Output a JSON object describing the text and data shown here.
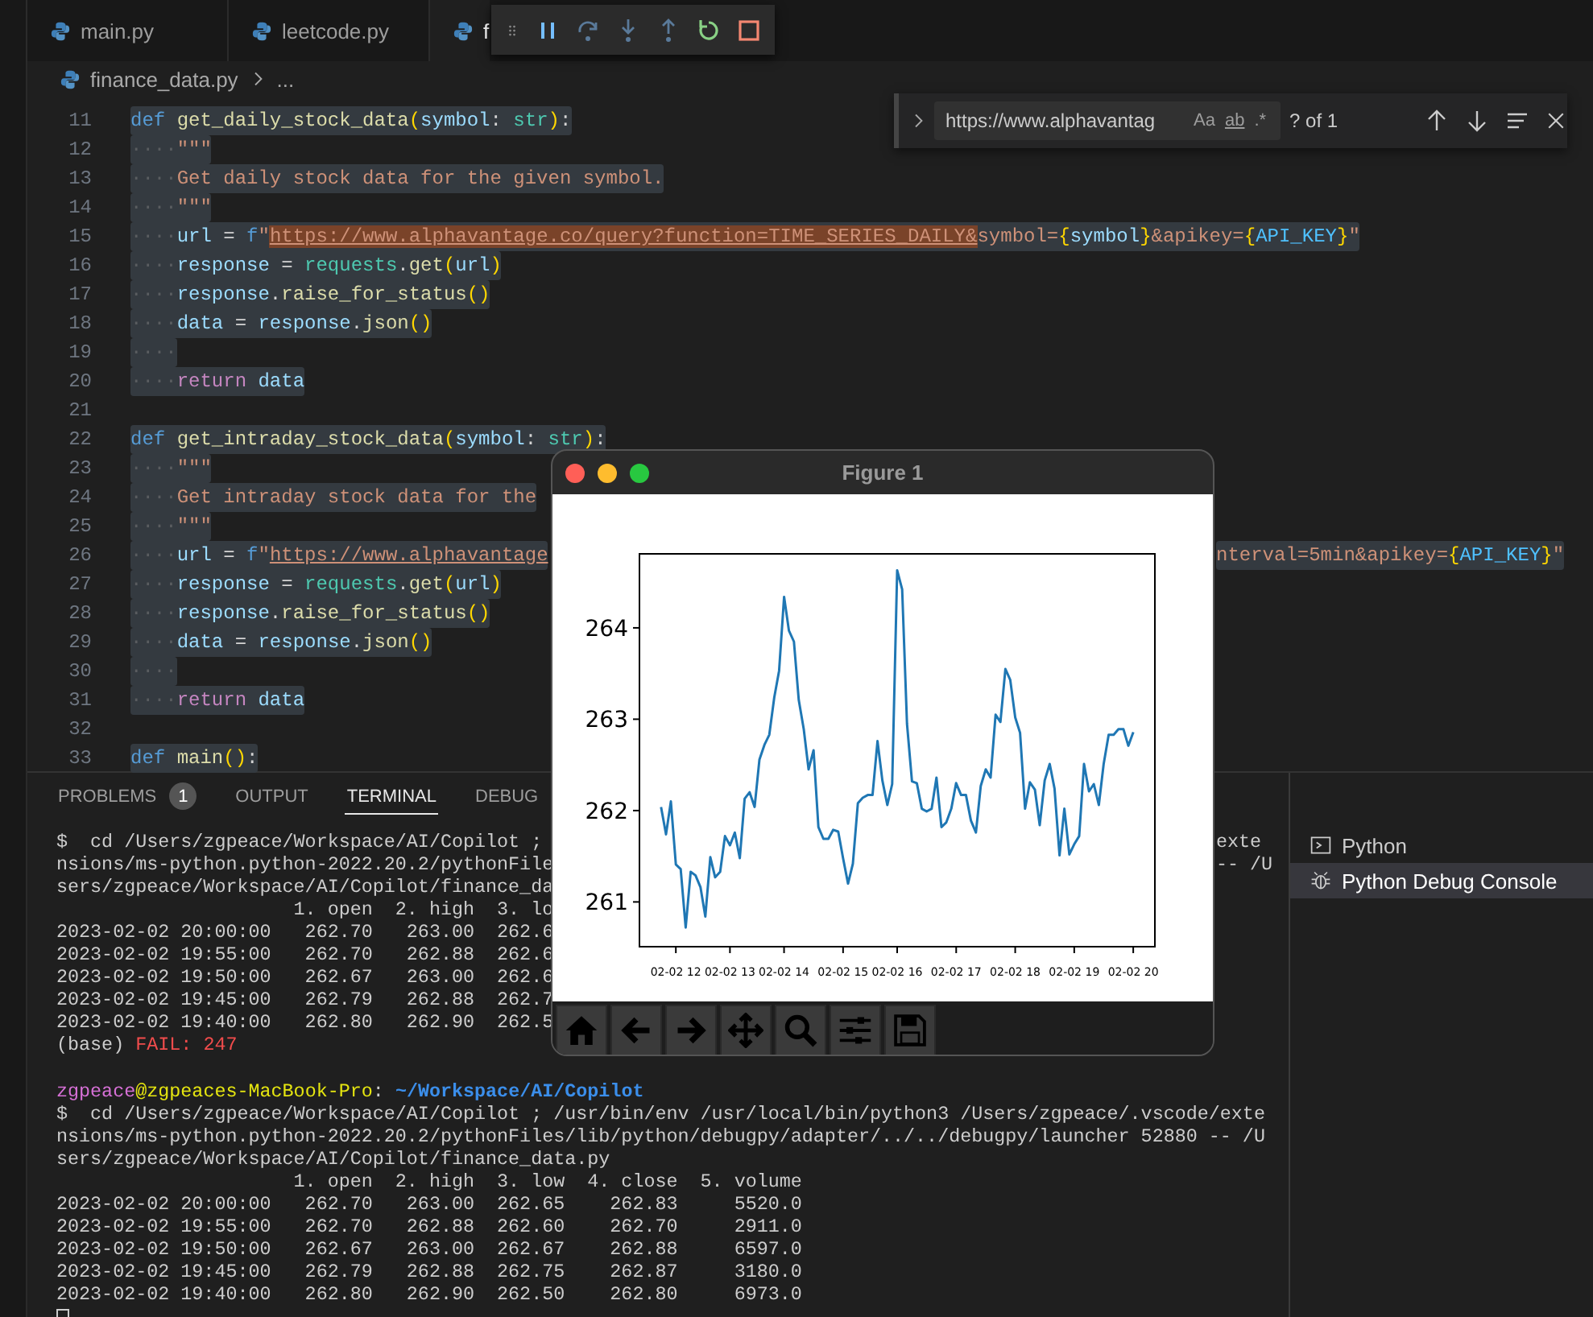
{
  "tabs": [
    {
      "label": "main.py",
      "selected": false
    },
    {
      "label": "leetcode.py",
      "selected": false
    },
    {
      "label": "f",
      "selected": true
    }
  ],
  "breadcrumb": {
    "file": "finance_data.py",
    "more": "..."
  },
  "find_widget": {
    "value": "https://www.alphavantag",
    "options": [
      "Aa",
      "ab",
      ".*"
    ],
    "result": "? of 1"
  },
  "editor": {
    "lines": [
      {
        "number": "11",
        "tokens": [
          {
            "text": "def ",
            "kind": "kw"
          },
          {
            "text": "get_daily_stock_data",
            "kind": "fn"
          },
          {
            "text": "(",
            "kind": "brace"
          },
          {
            "text": "symbol",
            "kind": "param"
          },
          {
            "text": ": ",
            "kind": "punc"
          },
          {
            "text": "str",
            "kind": "type"
          },
          {
            "text": ")",
            "kind": "brace"
          },
          {
            "text": ":",
            "kind": "punc"
          }
        ]
      },
      {
        "number": "12",
        "tokens": [
          {
            "text": "····",
            "kind": "ws"
          },
          {
            "text": "\"\"\"",
            "kind": "str"
          }
        ]
      },
      {
        "number": "13",
        "tokens": [
          {
            "text": "····",
            "kind": "ws"
          },
          {
            "text": "Get daily stock data for the given symbol.",
            "kind": "str"
          }
        ]
      },
      {
        "number": "14",
        "tokens": [
          {
            "text": "····",
            "kind": "ws"
          },
          {
            "text": "\"\"\"",
            "kind": "str"
          }
        ]
      },
      {
        "number": "15",
        "tokens": [
          {
            "text": "····",
            "kind": "ws"
          },
          {
            "text": "url",
            "kind": "var"
          },
          {
            "text": " = ",
            "kind": "punc"
          },
          {
            "text": "f",
            "kind": "kw"
          },
          {
            "text": "\"",
            "kind": "str"
          },
          {
            "text": "https://www.alphavantage.co/query?function=TIME_SERIES_DAILY&",
            "kind": "match"
          },
          {
            "text": "symbol=",
            "kind": "str"
          },
          {
            "text": "{",
            "kind": "brace"
          },
          {
            "text": "symbol",
            "kind": "var"
          },
          {
            "text": "}",
            "kind": "brace"
          },
          {
            "text": "&apikey=",
            "kind": "str"
          },
          {
            "text": "{",
            "kind": "brace"
          },
          {
            "text": "API_KEY",
            "kind": "const"
          },
          {
            "text": "}",
            "kind": "brace"
          },
          {
            "text": "\"",
            "kind": "str"
          }
        ]
      },
      {
        "number": "16",
        "tokens": [
          {
            "text": "····",
            "kind": "ws"
          },
          {
            "text": "response",
            "kind": "var"
          },
          {
            "text": " = ",
            "kind": "punc"
          },
          {
            "text": "requests",
            "kind": "type"
          },
          {
            "text": ".",
            "kind": "punc"
          },
          {
            "text": "get",
            "kind": "fn"
          },
          {
            "text": "(",
            "kind": "brace"
          },
          {
            "text": "url",
            "kind": "var"
          },
          {
            "text": ")",
            "kind": "brace"
          }
        ]
      },
      {
        "number": "17",
        "tokens": [
          {
            "text": "····",
            "kind": "ws"
          },
          {
            "text": "response",
            "kind": "var"
          },
          {
            "text": ".",
            "kind": "punc"
          },
          {
            "text": "raise_for_status",
            "kind": "fn"
          },
          {
            "text": "()",
            "kind": "brace"
          }
        ]
      },
      {
        "number": "18",
        "tokens": [
          {
            "text": "····",
            "kind": "ws"
          },
          {
            "text": "data",
            "kind": "var"
          },
          {
            "text": " = ",
            "kind": "punc"
          },
          {
            "text": "response",
            "kind": "var"
          },
          {
            "text": ".",
            "kind": "punc"
          },
          {
            "text": "json",
            "kind": "fn"
          },
          {
            "text": "()",
            "kind": "brace"
          }
        ]
      },
      {
        "number": "19",
        "tokens": [
          {
            "text": "····",
            "kind": "ws"
          }
        ]
      },
      {
        "number": "20",
        "tokens": [
          {
            "text": "····",
            "kind": "ws"
          },
          {
            "text": "return ",
            "kind": "ctrl"
          },
          {
            "text": "data",
            "kind": "var"
          }
        ]
      },
      {
        "number": "21"
      },
      {
        "number": "22",
        "tokens": [
          {
            "text": "def ",
            "kind": "kw"
          },
          {
            "text": "get_intraday_stock_data",
            "kind": "fn"
          },
          {
            "text": "(",
            "kind": "brace"
          },
          {
            "text": "symbol",
            "kind": "param"
          },
          {
            "text": ": ",
            "kind": "punc"
          },
          {
            "text": "str",
            "kind": "type"
          },
          {
            "text": ")",
            "kind": "brace"
          },
          {
            "text": ":",
            "kind": "punc"
          }
        ]
      },
      {
        "number": "23",
        "tokens": [
          {
            "text": "····",
            "kind": "ws"
          },
          {
            "text": "\"\"\"",
            "kind": "str"
          }
        ]
      },
      {
        "number": "24",
        "tokens": [
          {
            "text": "····",
            "kind": "ws"
          },
          {
            "text": "Get intraday stock data for the",
            "kind": "str"
          }
        ]
      },
      {
        "number": "25",
        "tokens": [
          {
            "text": "····",
            "kind": "ws"
          },
          {
            "text": "\"\"\"",
            "kind": "str"
          }
        ]
      },
      {
        "number": "26",
        "tokens": [
          {
            "text": "····",
            "kind": "ws"
          },
          {
            "text": "url",
            "kind": "var"
          },
          {
            "text": " = ",
            "kind": "punc"
          },
          {
            "text": "f",
            "kind": "kw"
          },
          {
            "text": "\"",
            "kind": "str"
          },
          {
            "text": "https://www.alphavantage",
            "kind": "link"
          }
        ],
        "tail": [
          {
            "text": "nterval=5min&apikey=",
            "kind": "str"
          },
          {
            "text": "{",
            "kind": "brace"
          },
          {
            "text": "API_KEY",
            "kind": "const"
          },
          {
            "text": "}",
            "kind": "brace"
          },
          {
            "text": "\"",
            "kind": "str"
          }
        ]
      },
      {
        "number": "27",
        "tokens": [
          {
            "text": "····",
            "kind": "ws"
          },
          {
            "text": "response",
            "kind": "var"
          },
          {
            "text": " = ",
            "kind": "punc"
          },
          {
            "text": "requests",
            "kind": "type"
          },
          {
            "text": ".",
            "kind": "punc"
          },
          {
            "text": "get",
            "kind": "fn"
          },
          {
            "text": "(",
            "kind": "brace"
          },
          {
            "text": "url",
            "kind": "var"
          },
          {
            "text": ")",
            "kind": "brace"
          }
        ]
      },
      {
        "number": "28",
        "tokens": [
          {
            "text": "····",
            "kind": "ws"
          },
          {
            "text": "response",
            "kind": "var"
          },
          {
            "text": ".",
            "kind": "punc"
          },
          {
            "text": "raise_for_status",
            "kind": "fn"
          },
          {
            "text": "()",
            "kind": "brace"
          }
        ]
      },
      {
        "number": "29",
        "tokens": [
          {
            "text": "····",
            "kind": "ws"
          },
          {
            "text": "data",
            "kind": "var"
          },
          {
            "text": " = ",
            "kind": "punc"
          },
          {
            "text": "response",
            "kind": "var"
          },
          {
            "text": ".",
            "kind": "punc"
          },
          {
            "text": "json",
            "kind": "fn"
          },
          {
            "text": "()",
            "kind": "brace"
          }
        ]
      },
      {
        "number": "30",
        "tokens": [
          {
            "text": "····",
            "kind": "ws"
          }
        ]
      },
      {
        "number": "31",
        "tokens": [
          {
            "text": "····",
            "kind": "ws"
          },
          {
            "text": "return ",
            "kind": "ctrl"
          },
          {
            "text": "data",
            "kind": "var"
          }
        ]
      },
      {
        "number": "32"
      },
      {
        "number": "33",
        "tokens": [
          {
            "text": "def ",
            "kind": "kw"
          },
          {
            "text": "main",
            "kind": "fn"
          },
          {
            "text": "()",
            "kind": "brace"
          },
          {
            "text": ":",
            "kind": "punc"
          }
        ]
      }
    ]
  },
  "panel": {
    "tabs": [
      {
        "label": "PROBLEMS",
        "badge": "1",
        "selected": false
      },
      {
        "label": "OUTPUT",
        "selected": false
      },
      {
        "label": "TERMINAL",
        "selected": true
      },
      {
        "label": "DEBUG",
        "selected": false
      }
    ],
    "sessions": [
      {
        "lines": [
          {
            "segments": [
              {
                "text": "$  cd /Users/zgpeace/Workspace/AI/Copilot ;",
                "kind": "plain"
              }
            ],
            "tail": "exte"
          },
          {
            "segments": [
              {
                "text": "nsions/ms-python.python-2022.20.2/pythonFile",
                "kind": "plain"
              }
            ],
            "tail": "-- /U"
          },
          {
            "segments": [
              {
                "text": "sers/zgpeace/Workspace/AI/Copilot/finance_da",
                "kind": "plain"
              }
            ]
          },
          {
            "segments": [
              {
                "text": "                     1. open  2. high  3. lo",
                "kind": "plain"
              }
            ]
          },
          {
            "segments": [
              {
                "text": "2023-02-02 20:00:00   262.70   263.00  262.6",
                "kind": "plain"
              }
            ]
          },
          {
            "segments": [
              {
                "text": "2023-02-02 19:55:00   262.70   262.88  262.6",
                "kind": "plain"
              }
            ]
          },
          {
            "segments": [
              {
                "text": "2023-02-02 19:50:00   262.67   263.00  262.6",
                "kind": "plain"
              }
            ]
          },
          {
            "segments": [
              {
                "text": "2023-02-02 19:45:00   262.79   262.88  262.7",
                "kind": "plain"
              }
            ]
          },
          {
            "segments": [
              {
                "text": "2023-02-02 19:40:00   262.80   262.90  262.5",
                "kind": "plain"
              }
            ]
          },
          {
            "segments": [
              {
                "text": "(base) ",
                "kind": "plain"
              },
              {
                "text": "FAIL: 247",
                "kind": "fail"
              }
            ]
          }
        ]
      },
      {
        "lines": [
          {
            "segments": [
              {
                "text": "zgpeace",
                "kind": "user"
              },
              {
                "text": "@zgpeaces-MacBook-Pro",
                "kind": "host"
              },
              {
                "text": ": ",
                "kind": "plain"
              },
              {
                "text": "~/Workspace/AI/Copilot",
                "kind": "path"
              }
            ]
          },
          {
            "segments": [
              {
                "text": "$  cd /Users/zgpeace/Workspace/AI/Copilot ; /usr/bin/env /usr/local/bin/python3 /Users/zgpeace/.vscode/exte",
                "kind": "plain"
              }
            ]
          },
          {
            "segments": [
              {
                "text": "nsions/ms-python.python-2022.20.2/pythonFiles/lib/python/debugpy/adapter/../../debugpy/launcher 52880 -- /U",
                "kind": "plain"
              }
            ]
          },
          {
            "segments": [
              {
                "text": "sers/zgpeace/Workspace/AI/Copilot/finance_data.py",
                "kind": "plain"
              }
            ]
          },
          {
            "segments": [
              {
                "text": "                     1. open  2. high  3. low  4. close  5. volume",
                "kind": "plain"
              }
            ]
          },
          {
            "segments": [
              {
                "text": "2023-02-02 20:00:00   262.70   263.00  262.65    262.83     5520.0",
                "kind": "plain"
              }
            ]
          },
          {
            "segments": [
              {
                "text": "2023-02-02 19:55:00   262.70   262.88  262.60    262.70     2911.0",
                "kind": "plain"
              }
            ]
          },
          {
            "segments": [
              {
                "text": "2023-02-02 19:50:00   262.67   263.00  262.67    262.88     6597.0",
                "kind": "plain"
              }
            ]
          },
          {
            "segments": [
              {
                "text": "2023-02-02 19:45:00   262.79   262.88  262.75    262.87     3180.0",
                "kind": "plain"
              }
            ]
          },
          {
            "segments": [
              {
                "text": "2023-02-02 19:40:00   262.80   262.90  262.50    262.80     6973.0",
                "kind": "plain"
              }
            ]
          }
        ]
      }
    ],
    "terminals": [
      {
        "label": "Python",
        "kind": "shell",
        "selected": false
      },
      {
        "label": "Python Debug Console",
        "kind": "debug",
        "selected": true
      }
    ]
  },
  "figure": {
    "title": "Figure 1",
    "chart_data": {
      "type": "line",
      "categories": [
        null,
        null,
        null,
        "02-02 12",
        null,
        null,
        null,
        null,
        null,
        null,
        null,
        null,
        null,
        null,
        "02-02 13",
        null,
        null,
        null,
        null,
        null,
        null,
        null,
        null,
        null,
        null,
        "02-02 14",
        null,
        null,
        null,
        null,
        null,
        null,
        null,
        null,
        null,
        null,
        null,
        "02-02 15",
        null,
        null,
        null,
        null,
        null,
        null,
        null,
        null,
        null,
        null,
        "02-02 16",
        null,
        null,
        null,
        null,
        null,
        null,
        null,
        null,
        null,
        null,
        null,
        "02-02 17",
        null,
        null,
        null,
        null,
        null,
        null,
        null,
        null,
        null,
        null,
        null,
        "02-02 18",
        null,
        null,
        null,
        null,
        null,
        null,
        null,
        null,
        null,
        null,
        null,
        "02-02 19",
        null,
        null,
        null,
        null,
        null,
        null,
        null,
        null,
        null,
        null,
        null,
        "02-02 20"
      ],
      "values": [
        262.04,
        261.74,
        262.1,
        261.41,
        261.36,
        260.72,
        261.33,
        261.29,
        261.16,
        260.84,
        261.49,
        261.27,
        261.33,
        261.72,
        261.62,
        261.76,
        261.48,
        262.13,
        262.2,
        262.04,
        262.56,
        262.72,
        262.83,
        263.24,
        263.53,
        264.34,
        263.97,
        263.85,
        263.21,
        262.89,
        262.45,
        262.66,
        261.82,
        261.69,
        261.69,
        261.79,
        261.77,
        261.48,
        261.2,
        261.42,
        262.08,
        262.14,
        262.17,
        262.17,
        262.76,
        262.33,
        262.06,
        262.29,
        264.63,
        264.42,
        262.95,
        262.32,
        262.3,
        262.02,
        261.99,
        262.02,
        262.36,
        261.82,
        261.87,
        262.02,
        262.3,
        262.17,
        262.17,
        261.89,
        261.76,
        262.27,
        262.45,
        262.36,
        263.05,
        262.97,
        263.55,
        263.43,
        263.02,
        262.85,
        262.02,
        262.31,
        262.23,
        261.84,
        262.33,
        262.51,
        262.24,
        261.51,
        262.02,
        261.52,
        261.63,
        261.72,
        262.51,
        262.21,
        262.29,
        262.06,
        262.51,
        262.83,
        262.83,
        262.89,
        262.89,
        262.71,
        262.86
      ],
      "ylim": [
        260.51,
        264.81
      ],
      "yticks": [
        261,
        262,
        263,
        264
      ]
    }
  }
}
